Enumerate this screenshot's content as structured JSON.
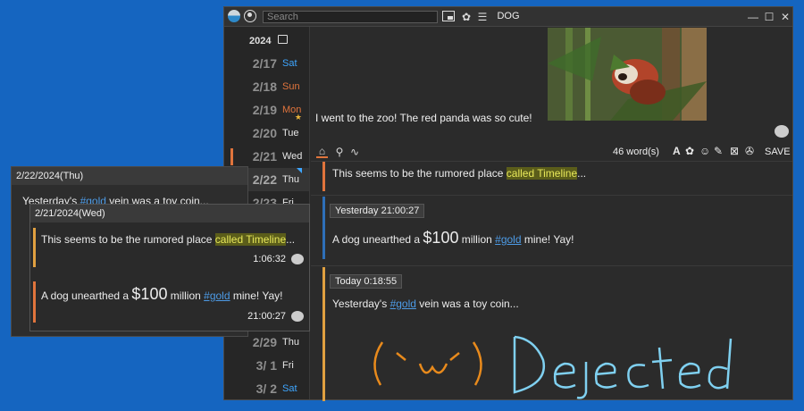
{
  "window": {
    "title": "DOG",
    "search_placeholder": "Search"
  },
  "calendar": {
    "year": "2024",
    "days": [
      {
        "date": "2/17",
        "day": "Sat",
        "color": "#3ea6ff"
      },
      {
        "date": "2/18",
        "day": "Sun",
        "color": "#e0743c"
      },
      {
        "date": "2/19",
        "day": "Mon",
        "color": "#e0743c"
      },
      {
        "date": "2/20",
        "day": "Tue",
        "color": "#e6e6e6"
      },
      {
        "date": "2/21",
        "day": "Wed",
        "color": "#e6e6e6"
      },
      {
        "date": "2/22",
        "day": "Thu",
        "color": "#e6e6e6"
      },
      {
        "date": "2/23",
        "day": "Fri",
        "color": "#e6e6e6"
      },
      {
        "date": "2/29",
        "day": "Thu",
        "color": "#e6e6e6"
      },
      {
        "date": "3/ 1",
        "day": "Fri",
        "color": "#e6e6e6"
      },
      {
        "date": "3/ 2",
        "day": "Sat",
        "color": "#3ea6ff"
      }
    ]
  },
  "entry": {
    "caption": "I went to the zoo! The red panda was so cute!",
    "word_count": "46 word(s)",
    "save_label": "SAVE"
  },
  "timeline": {
    "entry1_prefix": "This seems to be the rumored place ",
    "entry1_highlight": "called Timeline",
    "entry1_suffix": "...",
    "entry2_time": "Yesterday 21:00:27",
    "entry2_prefix": "A dog unearthed a ",
    "entry2_money": "$100",
    "entry2_mid": " million ",
    "entry2_tag": "#gold",
    "entry2_suffix": " mine! Yay!",
    "entry3_time": "Today 0:18:55",
    "entry3_prefix": "Yesterday's ",
    "entry3_tag": "#gold",
    "entry3_suffix": " vein was a toy coin...",
    "handwriting_face": "(`ω´)",
    "handwriting_word": "Dejected"
  },
  "popup22": {
    "header": "2/22/2024(Thu)",
    "text_prefix": "Yesterday's ",
    "text_tag": "#gold",
    "text_suffix": " vein was a toy coin..."
  },
  "popup21": {
    "header": "2/21/2024(Wed)",
    "e1_prefix": "This seems to be the rumored place ",
    "e1_highlight": "called Timeline",
    "e1_suffix": "...",
    "e1_time": "1:06:32",
    "e2_prefix": "A dog unearthed a ",
    "e2_money": "$100",
    "e2_mid": " million ",
    "e2_tag": "#gold",
    "e2_suffix": " mine! Yay!",
    "e2_time": "21:00:27"
  },
  "colors": {
    "accent_orange": "#e0743c",
    "accent_yellow": "#e0a040",
    "accent_blue": "#3ea6ff",
    "tag_blue": "#4d9be6"
  }
}
